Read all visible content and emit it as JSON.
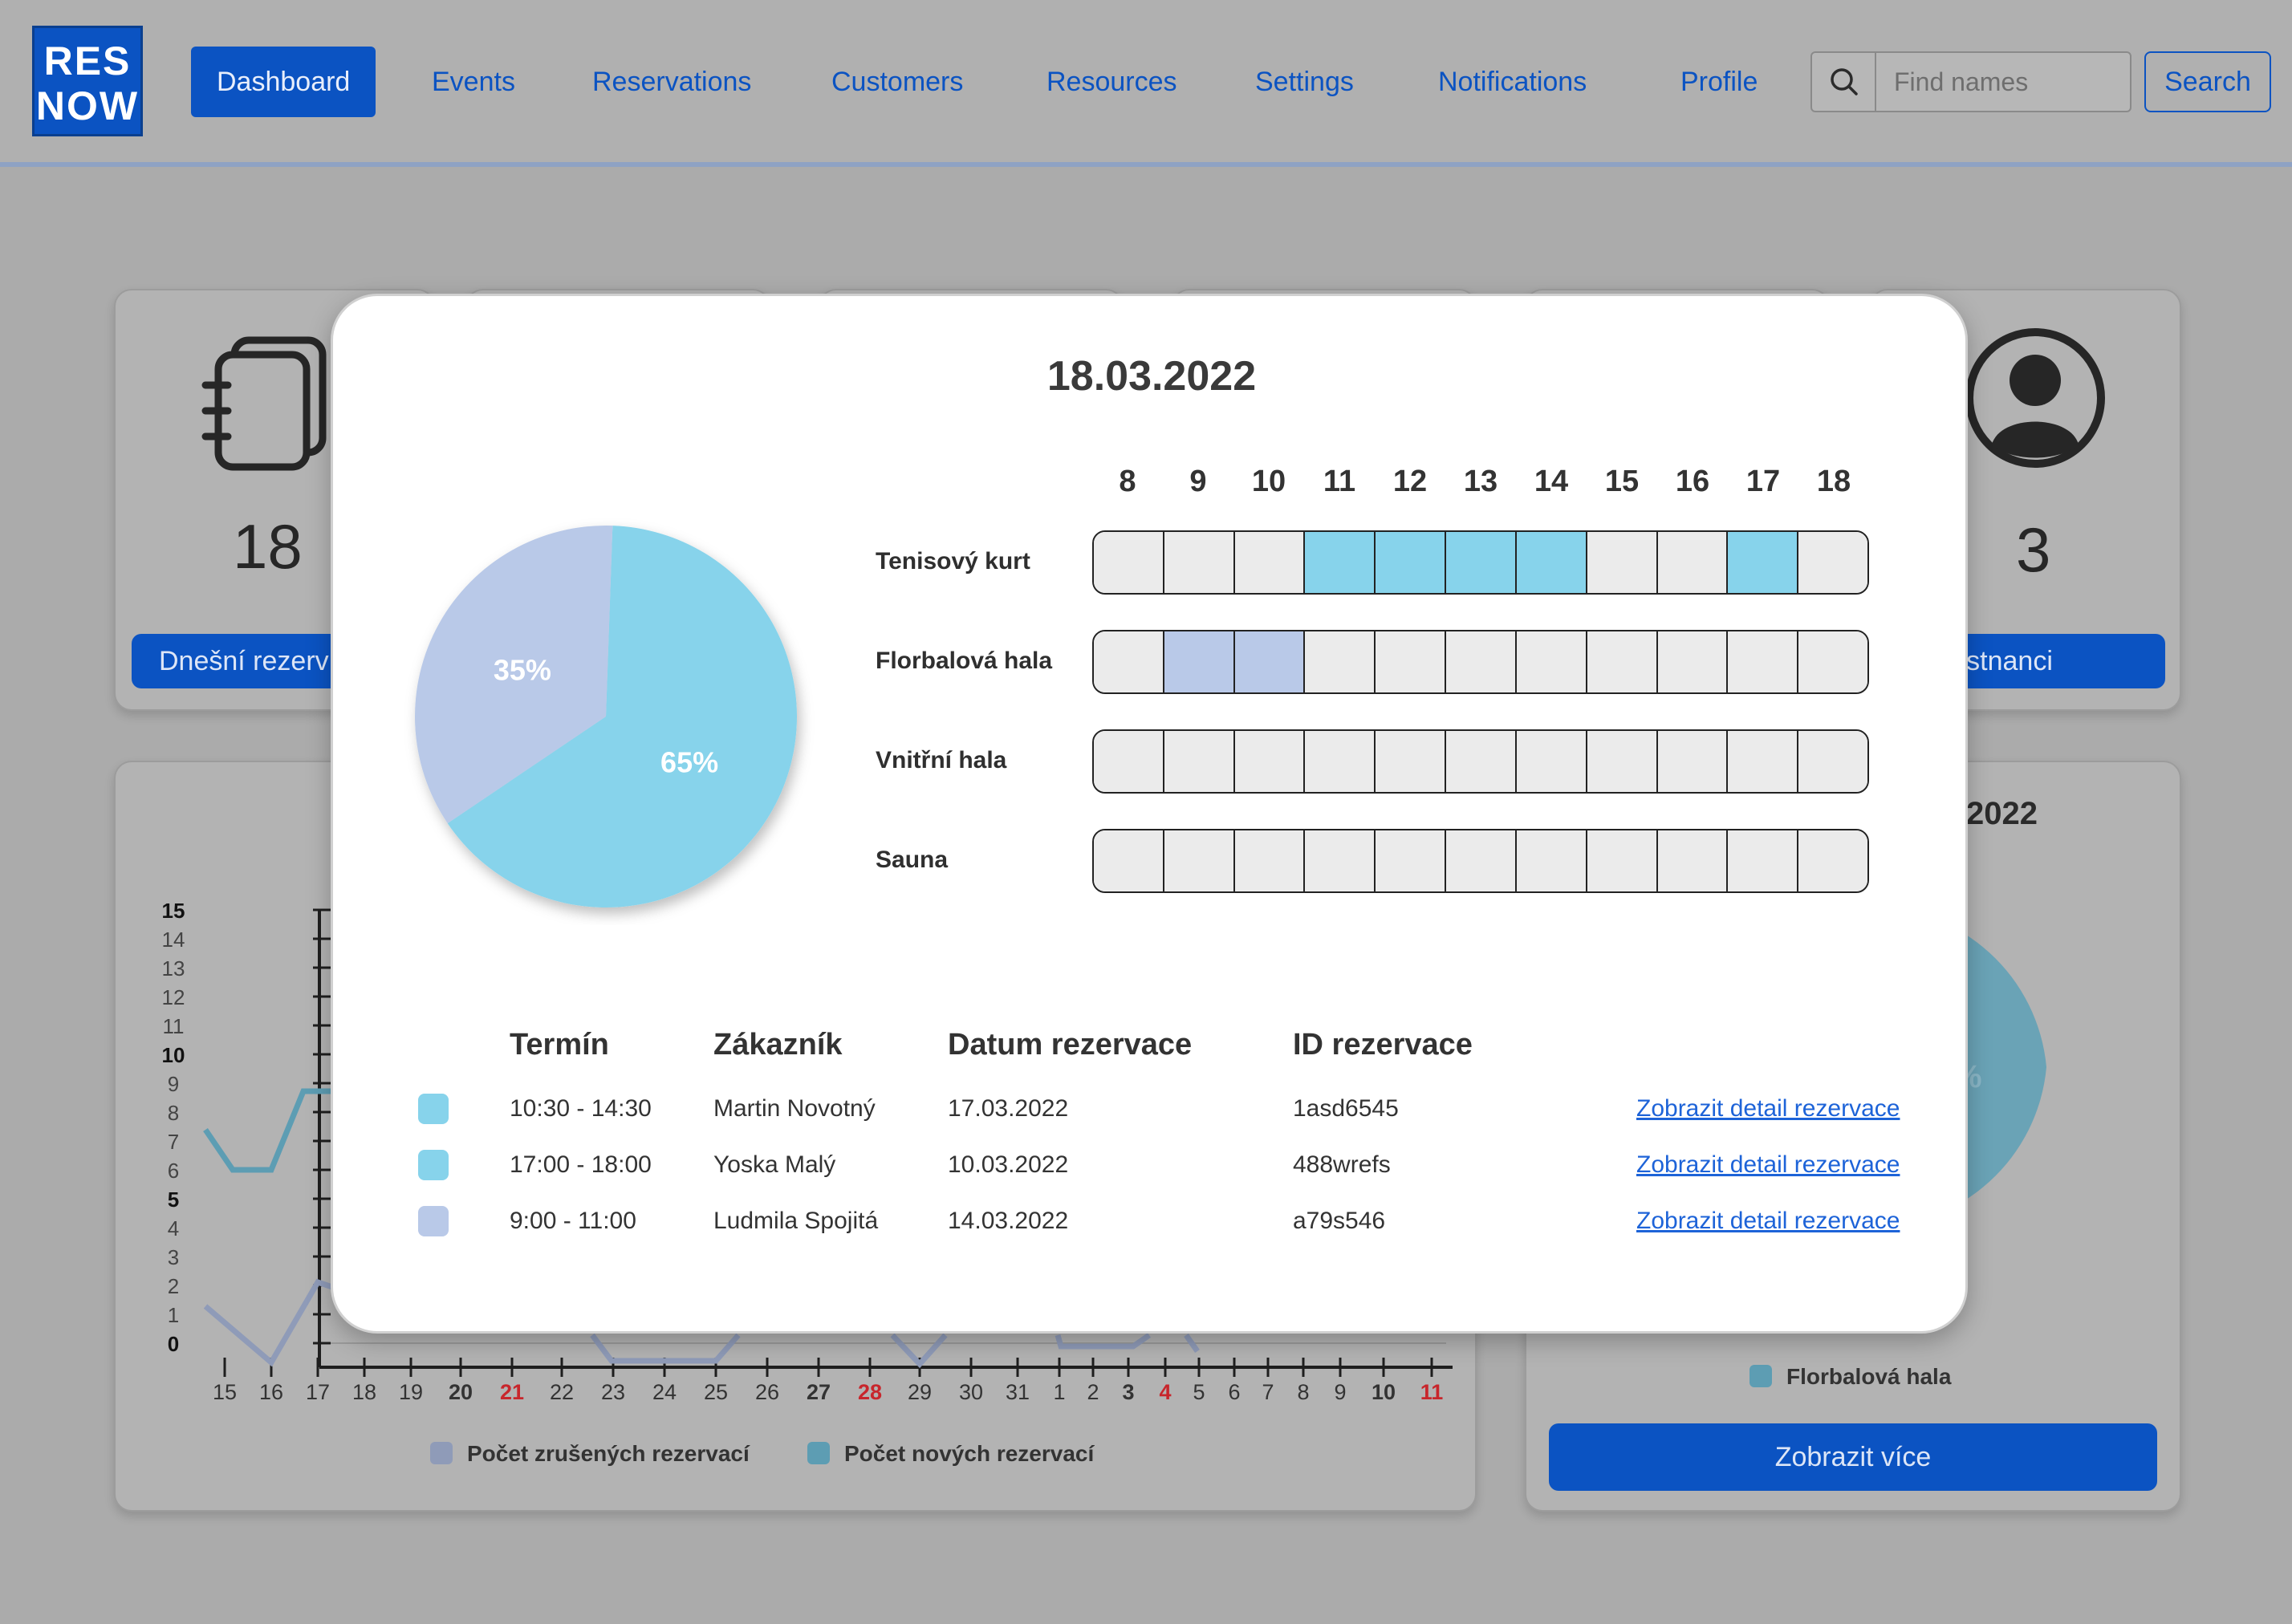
{
  "nav": {
    "logo_line1": "RES",
    "logo_line2": "NOW",
    "items": [
      {
        "label": "Dashboard",
        "active": true
      },
      {
        "label": "Events"
      },
      {
        "label": "Reservations"
      },
      {
        "label": "Customers"
      },
      {
        "label": "Resources"
      },
      {
        "label": "Settings"
      },
      {
        "label": "Notifications"
      },
      {
        "label": "Profile"
      }
    ],
    "search_placeholder": "Find names",
    "search_button": "Search"
  },
  "background": {
    "stat_left_value": "18",
    "stat_left_button": "Dnešní rezerv",
    "stat_right_value": "3",
    "stat_right_button": "aměstnanci",
    "right_card_title_fragment": "2022",
    "right_card_percent_fragment": "%",
    "right_card_legend": "Florbalová hala",
    "right_card_button": "Zobrazit více",
    "line_chart": {
      "y_ticks": [
        "15",
        "14",
        "13",
        "12",
        "11",
        "10",
        "9",
        "8",
        "7",
        "6",
        "5",
        "4",
        "3",
        "2",
        "1",
        "0"
      ],
      "x_ticks": [
        {
          "t": "15"
        },
        {
          "t": "16"
        },
        {
          "t": "17"
        },
        {
          "t": "18"
        },
        {
          "t": "19"
        },
        {
          "t": "20",
          "bold": true
        },
        {
          "t": "21",
          "red": true
        },
        {
          "t": "22"
        },
        {
          "t": "23"
        },
        {
          "t": "24"
        },
        {
          "t": "25"
        },
        {
          "t": "26"
        },
        {
          "t": "27",
          "bold": true
        },
        {
          "t": "28",
          "red": true
        },
        {
          "t": "29"
        },
        {
          "t": "30"
        },
        {
          "t": "31"
        },
        {
          "t": "1"
        },
        {
          "t": "2"
        },
        {
          "t": "3",
          "bold": true
        },
        {
          "t": "4",
          "red": true
        },
        {
          "t": "5"
        },
        {
          "t": "6"
        },
        {
          "t": "7"
        },
        {
          "t": "8"
        },
        {
          "t": "9"
        },
        {
          "t": "10",
          "bold": true
        },
        {
          "t": "11",
          "red": true
        }
      ],
      "legend_cancelled": "Počet zrušených rezervací",
      "legend_new": "Počet nových rezervací",
      "color_cancelled": "#8f9bb8",
      "color_new": "#5d9db3"
    }
  },
  "modal": {
    "date": "18.03.2022",
    "pie": {
      "slices": [
        {
          "label": "65%",
          "value": 65,
          "color": "#87d3eb"
        },
        {
          "label": "35%",
          "value": 35,
          "color": "#b9c9e8"
        }
      ]
    },
    "hours": [
      "8",
      "9",
      "10",
      "11",
      "12",
      "13",
      "14",
      "15",
      "16",
      "17",
      "18"
    ],
    "resources": [
      {
        "name": "Tenisový kurt",
        "slots": [
          "",
          "",
          "",
          "c",
          "c",
          "c",
          "c",
          "",
          "",
          "c",
          ""
        ]
      },
      {
        "name": "Florbalová hala",
        "slots": [
          "",
          "f",
          "f",
          "",
          "",
          "",
          "",
          "",
          "",
          "",
          ""
        ]
      },
      {
        "name": "Vnitřní hala",
        "slots": [
          "",
          "",
          "",
          "",
          "",
          "",
          "",
          "",
          "",
          "",
          ""
        ]
      },
      {
        "name": "Sauna",
        "slots": [
          "",
          "",
          "",
          "",
          "",
          "",
          "",
          "",
          "",
          "",
          ""
        ]
      }
    ],
    "table": {
      "headers": [
        "Termín",
        "Zákazník",
        "Datum rezervace",
        "ID rezervace"
      ],
      "rows": [
        {
          "color": "#87d3eb",
          "term": "10:30 - 14:30",
          "customer": "Martin Novotný",
          "date": "17.03.2022",
          "id": "1asd6545",
          "link": "Zobrazit detail rezervace"
        },
        {
          "color": "#87d3eb",
          "term": "17:00 - 18:00",
          "customer": "Yoska Malý",
          "date": "10.03.2022",
          "id": "488wrefs",
          "link": "Zobrazit detail rezervace"
        },
        {
          "color": "#b9c9e8",
          "term": "9:00 - 11:00",
          "customer": "Ludmila Spojitá",
          "date": "14.03.2022",
          "id": "a79s546",
          "link": "Zobrazit detail rezervace"
        }
      ]
    }
  }
}
